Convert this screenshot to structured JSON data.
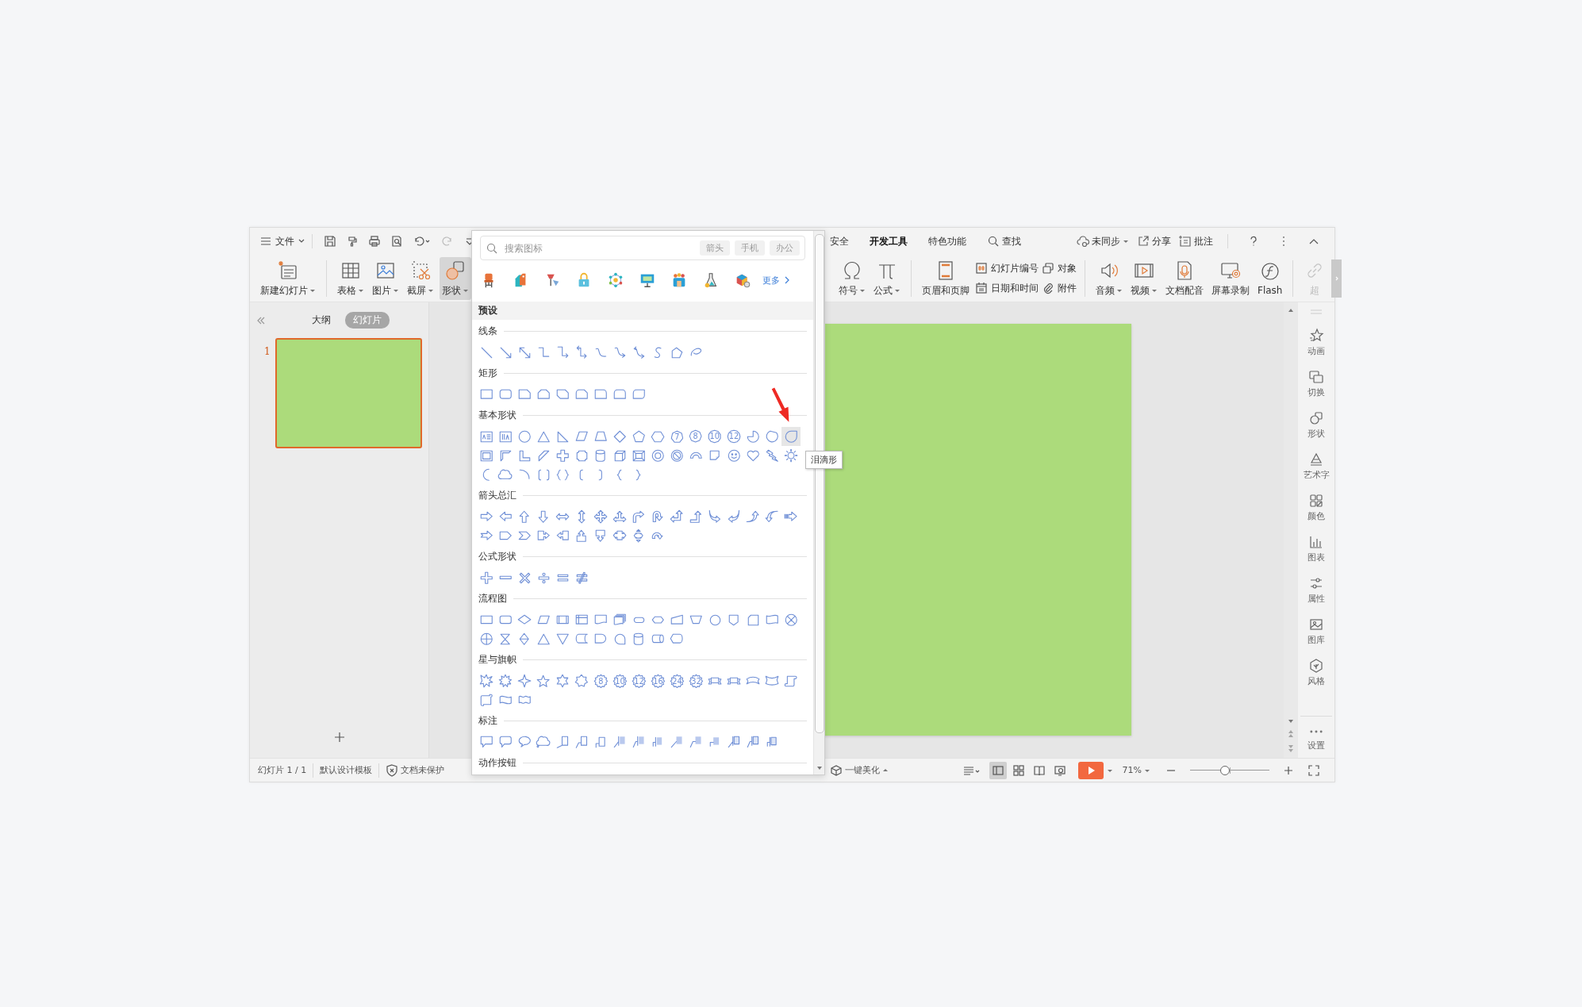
{
  "toolbar": {
    "file_menu": "文件",
    "tabs": [
      {
        "label": "安全",
        "selected": false
      },
      {
        "label": "开发工具",
        "selected": true
      },
      {
        "label": "特色功能",
        "selected": false
      }
    ],
    "find": "查找",
    "sync": "未同步",
    "share": "分享",
    "comment": "批注"
  },
  "ribbon": {
    "left_groups": [
      [
        {
          "label": "新建幻灯片",
          "dropdown": true,
          "selected": false
        }
      ],
      [
        {
          "label": "表格",
          "dropdown": true,
          "selected": false
        },
        {
          "label": "图片",
          "dropdown": true,
          "selected": false
        },
        {
          "label": "截屏",
          "dropdown": true,
          "selected": false
        },
        {
          "label": "形状",
          "dropdown": true,
          "selected": true
        }
      ]
    ],
    "right_groups": [
      [
        {
          "kind": "large",
          "label": "符号",
          "dropdown": true,
          "disabled": false
        },
        {
          "kind": "large",
          "label": "公式",
          "dropdown": true,
          "disabled": false
        }
      ],
      [
        {
          "kind": "large",
          "label": "页眉和页脚",
          "dropdown": false,
          "disabled": false
        },
        {
          "kind": "stack",
          "items": [
            "幻灯片编号",
            "日期和时间"
          ]
        },
        {
          "kind": "stack",
          "items": [
            "对象",
            "附件"
          ]
        }
      ],
      [
        {
          "kind": "large",
          "label": "音频",
          "dropdown": true,
          "disabled": false
        },
        {
          "kind": "large",
          "label": "视频",
          "dropdown": true,
          "disabled": false
        },
        {
          "kind": "large",
          "label": "文档配音",
          "dropdown": false,
          "disabled": false
        },
        {
          "kind": "large",
          "label": "屏幕录制",
          "dropdown": false,
          "disabled": false
        },
        {
          "kind": "large",
          "label": "Flash",
          "dropdown": false,
          "disabled": false
        }
      ],
      [
        {
          "kind": "large",
          "label": "超",
          "dropdown": false,
          "disabled": true
        }
      ]
    ]
  },
  "slides_panel": {
    "tabs": [
      {
        "label": "大纲",
        "selected": false
      },
      {
        "label": "幻灯片",
        "selected": true
      }
    ],
    "slides": [
      {
        "number": "1",
        "selected": true
      }
    ]
  },
  "shape_panel": {
    "search": {
      "placeholder": "搜索图标"
    },
    "chips": [
      "箭头",
      "手机",
      "办公"
    ],
    "more": "更多",
    "category": "预设",
    "tooltip": "泪滴形",
    "sections": [
      {
        "title": "线条",
        "shapes": [
          {
            "kind": "line",
            "selected": false
          },
          {
            "kind": "arrow",
            "selected": false
          },
          {
            "kind": "double-arrow",
            "selected": false
          },
          {
            "kind": "elbow",
            "selected": false
          },
          {
            "kind": "elbow-arrow",
            "selected": false
          },
          {
            "kind": "elbow-double-arrow",
            "selected": false
          },
          {
            "kind": "curve",
            "selected": false
          },
          {
            "kind": "curve-arrow",
            "selected": false
          },
          {
            "kind": "curve-double-arrow",
            "selected": false
          },
          {
            "kind": "s-curve",
            "selected": false
          },
          {
            "kind": "freeform",
            "selected": false
          },
          {
            "kind": "scribble",
            "selected": false
          }
        ]
      },
      {
        "title": "矩形",
        "shapes": [
          {
            "kind": "rect",
            "selected": false
          },
          {
            "kind": "round-rect",
            "selected": false
          },
          {
            "kind": "snip-corner",
            "selected": false
          },
          {
            "kind": "snip-same",
            "selected": false
          },
          {
            "kind": "snip-diagonal",
            "selected": false
          },
          {
            "kind": "snip-round",
            "selected": false
          },
          {
            "kind": "round-one",
            "selected": false
          },
          {
            "kind": "round-same",
            "selected": false
          },
          {
            "kind": "round-diagonal",
            "selected": false
          }
        ]
      },
      {
        "title": "基本形状",
        "shapes": [
          {
            "kind": "text-box",
            "selected": false
          },
          {
            "kind": "vertical-text",
            "selected": false
          },
          {
            "kind": "ellipse",
            "selected": false
          },
          {
            "kind": "triangle",
            "selected": false
          },
          {
            "kind": "right-triangle",
            "selected": false
          },
          {
            "kind": "parallelogram",
            "selected": false
          },
          {
            "kind": "trapezoid",
            "selected": false
          },
          {
            "kind": "diamond",
            "selected": false
          },
          {
            "kind": "pentagon",
            "selected": false
          },
          {
            "kind": "hexagon",
            "selected": false
          },
          {
            "kind": "heptagon",
            "label": "7",
            "selected": false
          },
          {
            "kind": "octagon",
            "label": "8",
            "selected": false
          },
          {
            "kind": "decagon",
            "label": "10",
            "selected": false
          },
          {
            "kind": "dodecagon",
            "label": "12",
            "selected": false
          },
          {
            "kind": "pie",
            "selected": false
          },
          {
            "kind": "chord",
            "selected": false
          },
          {
            "kind": "teardrop",
            "selected": true
          },
          {
            "kind": "frame",
            "selected": false
          },
          {
            "kind": "half-frame",
            "selected": false
          },
          {
            "kind": "l-shape",
            "selected": false
          },
          {
            "kind": "diagonal-stripe",
            "selected": false
          },
          {
            "kind": "cross",
            "selected": false
          },
          {
            "kind": "plaque",
            "selected": false
          },
          {
            "kind": "can",
            "selected": false
          },
          {
            "kind": "cube",
            "selected": false
          },
          {
            "kind": "bevel",
            "selected": false
          },
          {
            "kind": "donut",
            "selected": false
          },
          {
            "kind": "no-symbol",
            "selected": false
          },
          {
            "kind": "block-arc",
            "selected": false
          },
          {
            "kind": "folded-corner",
            "selected": false
          },
          {
            "kind": "smiley",
            "selected": false
          },
          {
            "kind": "heart",
            "selected": false
          },
          {
            "kind": "lightning",
            "selected": false
          },
          {
            "kind": "sun",
            "selected": false
          },
          {
            "kind": "moon",
            "selected": false
          },
          {
            "kind": "cloud",
            "selected": false
          },
          {
            "kind": "arc",
            "selected": false
          },
          {
            "kind": "bracket-pair",
            "selected": false
          },
          {
            "kind": "brace-pair",
            "selected": false
          },
          {
            "kind": "left-bracket",
            "selected": false
          },
          {
            "kind": "right-bracket",
            "selected": false
          },
          {
            "kind": "left-brace",
            "selected": false
          },
          {
            "kind": "right-brace",
            "selected": false
          }
        ]
      },
      {
        "title": "箭头总汇",
        "shapes": [
          {
            "kind": "right-arrow",
            "selected": false
          },
          {
            "kind": "left-arrow",
            "selected": false
          },
          {
            "kind": "up-arrow",
            "selected": false
          },
          {
            "kind": "down-arrow",
            "selected": false
          },
          {
            "kind": "left-right-arrow",
            "selected": false
          },
          {
            "kind": "up-down-arrow",
            "selected": false
          },
          {
            "kind": "quad-arrow",
            "selected": false
          },
          {
            "kind": "left-right-up-arrow",
            "selected": false
          },
          {
            "kind": "bent-arrow",
            "selected": false
          },
          {
            "kind": "u-turn-arrow",
            "selected": false
          },
          {
            "kind": "left-up-arrow",
            "selected": false
          },
          {
            "kind": "bent-up-arrow",
            "selected": false
          },
          {
            "kind": "curved-right-arrow",
            "selected": false
          },
          {
            "kind": "curved-left-arrow",
            "selected": false
          },
          {
            "kind": "curved-up-arrow",
            "selected": false
          },
          {
            "kind": "curved-down-arrow",
            "selected": false
          },
          {
            "kind": "striped-right-arrow",
            "selected": false
          },
          {
            "kind": "notched-right-arrow",
            "selected": false
          },
          {
            "kind": "pentagon-arrow",
            "selected": false
          },
          {
            "kind": "chevron",
            "selected": false
          },
          {
            "kind": "right-arrow-callout",
            "selected": false
          },
          {
            "kind": "left-arrow-callout",
            "selected": false
          },
          {
            "kind": "up-arrow-callout",
            "selected": false
          },
          {
            "kind": "down-arrow-callout",
            "selected": false
          },
          {
            "kind": "left-right-arrow-callout",
            "selected": false
          },
          {
            "kind": "quad-arrow-callout",
            "selected": false
          },
          {
            "kind": "circular-arrow",
            "selected": false
          }
        ]
      },
      {
        "title": "公式形状",
        "shapes": [
          {
            "kind": "plus",
            "selected": false
          },
          {
            "kind": "minus",
            "selected": false
          },
          {
            "kind": "multiply",
            "selected": false
          },
          {
            "kind": "divide",
            "selected": false
          },
          {
            "kind": "equal",
            "selected": false
          },
          {
            "kind": "not-equal",
            "selected": false
          }
        ]
      },
      {
        "title": "流程图",
        "shapes": [
          {
            "kind": "process",
            "selected": false
          },
          {
            "kind": "alternate-process",
            "selected": false
          },
          {
            "kind": "decision",
            "selected": false
          },
          {
            "kind": "data",
            "selected": false
          },
          {
            "kind": "predefined-process",
            "selected": false
          },
          {
            "kind": "internal-storage",
            "selected": false
          },
          {
            "kind": "document",
            "selected": false
          },
          {
            "kind": "multidocument",
            "selected": false
          },
          {
            "kind": "terminator",
            "selected": false
          },
          {
            "kind": "preparation",
            "selected": false
          },
          {
            "kind": "manual-input",
            "selected": false
          },
          {
            "kind": "manual-operation",
            "selected": false
          },
          {
            "kind": "connector",
            "selected": false
          },
          {
            "kind": "off-page-connector",
            "selected": false
          },
          {
            "kind": "card",
            "selected": false
          },
          {
            "kind": "punched-tape",
            "selected": false
          },
          {
            "kind": "summing-junction",
            "selected": false
          },
          {
            "kind": "or",
            "selected": false
          },
          {
            "kind": "collate",
            "selected": false
          },
          {
            "kind": "sort",
            "selected": false
          },
          {
            "kind": "extract",
            "selected": false
          },
          {
            "kind": "merge",
            "selected": false
          },
          {
            "kind": "stored-data",
            "selected": false
          },
          {
            "kind": "delay",
            "selected": false
          },
          {
            "kind": "sequential-access",
            "selected": false
          },
          {
            "kind": "magnetic-disk",
            "selected": false
          },
          {
            "kind": "direct-access",
            "selected": false
          },
          {
            "kind": "display",
            "selected": false
          }
        ]
      },
      {
        "title": "星与旗帜",
        "shapes": [
          {
            "kind": "explosion",
            "selected": false
          },
          {
            "kind": "explosion-2",
            "selected": false
          },
          {
            "kind": "star-4",
            "selected": false
          },
          {
            "kind": "star-5",
            "selected": false
          },
          {
            "kind": "star-6",
            "selected": false
          },
          {
            "kind": "star-7",
            "selected": false
          },
          {
            "kind": "star-badge",
            "label": "8",
            "selected": false
          },
          {
            "kind": "star-badge",
            "label": "10",
            "selected": false
          },
          {
            "kind": "star-badge",
            "label": "12",
            "selected": false
          },
          {
            "kind": "star-badge",
            "label": "16",
            "selected": false
          },
          {
            "kind": "star-badge",
            "label": "24",
            "selected": false
          },
          {
            "kind": "star-badge",
            "label": "32",
            "selected": false
          },
          {
            "kind": "ribbon-down",
            "selected": false
          },
          {
            "kind": "ribbon-up",
            "selected": false
          },
          {
            "kind": "curved-ribbon-down",
            "selected": false
          },
          {
            "kind": "curved-ribbon-up",
            "selected": false
          },
          {
            "kind": "vertical-scroll",
            "selected": false
          },
          {
            "kind": "horizontal-scroll",
            "selected": false
          },
          {
            "kind": "wave",
            "selected": false
          },
          {
            "kind": "double-wave",
            "selected": false
          }
        ]
      },
      {
        "title": "标注",
        "shapes": [
          {
            "kind": "rect-callout",
            "selected": false
          },
          {
            "kind": "round-rect-callout",
            "selected": false
          },
          {
            "kind": "oval-callout",
            "selected": false
          },
          {
            "kind": "cloud-callout",
            "selected": false
          },
          {
            "kind": "line-callout",
            "selected": false
          },
          {
            "kind": "line-callout-2",
            "selected": false
          },
          {
            "kind": "line-callout-3",
            "selected": false
          },
          {
            "kind": "accent-callout",
            "selected": false
          },
          {
            "kind": "accent-callout-2",
            "selected": false
          },
          {
            "kind": "accent-callout-3",
            "selected": false
          },
          {
            "kind": "filled-callout",
            "selected": false
          },
          {
            "kind": "filled-callout-2",
            "selected": false
          },
          {
            "kind": "filled-callout-3",
            "selected": false
          },
          {
            "kind": "bordered-callout",
            "selected": false
          },
          {
            "kind": "bordered-callout-2",
            "selected": false
          },
          {
            "kind": "bordered-callout-3",
            "selected": false
          }
        ]
      },
      {
        "title": "动作按钮"
      }
    ]
  },
  "sidebar": {
    "items": [
      "动画",
      "切换",
      "形状",
      "艺术字",
      "颜色",
      "图表",
      "属性",
      "图库",
      "风格"
    ],
    "footer": "设置"
  },
  "status_bar": {
    "slide_info": "幻灯片 1 / 1",
    "template": "默认设计模板",
    "protection": "文档未保护",
    "beautify": "一键美化",
    "views": [
      {
        "selected": true
      },
      {
        "selected": false
      },
      {
        "selected": false
      },
      {
        "selected": false
      }
    ],
    "zoom": "71%",
    "level": 0.44
  }
}
